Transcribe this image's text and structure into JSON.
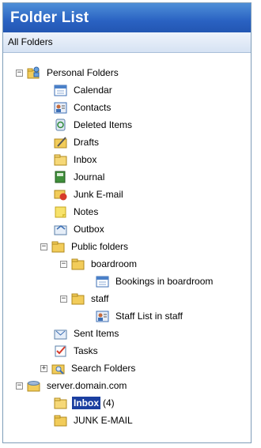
{
  "header": {
    "title": "Folder List"
  },
  "subheader": {
    "label": "All Folders"
  },
  "tree": {
    "personal": "Personal Folders",
    "calendar": "Calendar",
    "contacts": "Contacts",
    "deleted": "Deleted Items",
    "drafts": "Drafts",
    "inbox": "Inbox",
    "journal": "Journal",
    "junk": "Junk E-mail",
    "notes": "Notes",
    "outbox": "Outbox",
    "public": "Public folders",
    "boardroom": "boardroom",
    "bookings": "Bookings in boardroom",
    "staff": "staff",
    "staff_list": "Staff List in staff",
    "sent": "Sent Items",
    "tasks": "Tasks",
    "search": "Search Folders",
    "server": "server.domain.com",
    "server_inbox": "Inbox",
    "server_inbox_count": "(4)",
    "server_junk": "JUNK E-MAIL"
  },
  "expanders": {
    "minus": "−",
    "plus": "+"
  },
  "colors": {
    "header_bg": "#2a62c2",
    "selection_bg": "#1b3fa0",
    "border": "#7f9db9"
  },
  "icons": {
    "personal": "personal-folders-icon",
    "calendar": "calendar-icon",
    "contacts": "contacts-icon",
    "deleted": "deleted-items-icon",
    "drafts": "drafts-icon",
    "inbox": "inbox-icon",
    "journal": "journal-icon",
    "junk": "junk-mail-icon",
    "notes": "notes-icon",
    "outbox": "outbox-icon",
    "folder": "folder-icon",
    "bookings": "calendar-icon",
    "staff_list": "contacts-icon",
    "sent": "sent-items-icon",
    "tasks": "tasks-icon",
    "search": "search-folders-icon",
    "server": "server-mailbox-icon"
  }
}
